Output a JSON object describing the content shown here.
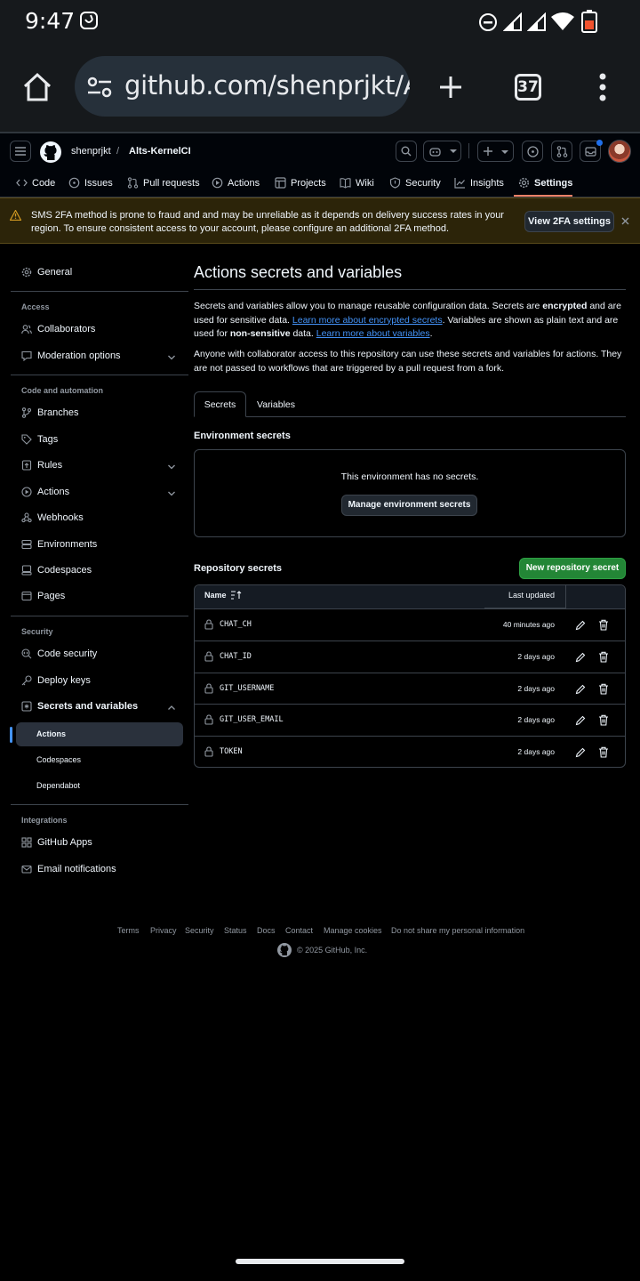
{
  "status_bar": {
    "time": "9:47"
  },
  "browser": {
    "url": "github.com/shenprjkt/Alt",
    "tab_count": "37"
  },
  "header": {
    "owner": "shenprjkt",
    "separator": "/",
    "repo": "Alts-KernelCI"
  },
  "repo_nav": {
    "tabs": [
      "Code",
      "Issues",
      "Pull requests",
      "Actions",
      "Projects",
      "Wiki",
      "Security",
      "Insights",
      "Settings"
    ],
    "active_tab": "Settings"
  },
  "banner": {
    "message": "SMS 2FA method is prone to fraud and and may be unreliable as it depends on delivery success rates in your region. To ensure consistent access to your account, please configure an additional 2FA method.",
    "button": "View 2FA settings"
  },
  "sidebar": {
    "general": "General",
    "access_heading": "Access",
    "collaborators": "Collaborators",
    "moderation": "Moderation options",
    "code_heading": "Code and automation",
    "branches": "Branches",
    "tags": "Tags",
    "rules": "Rules",
    "actions": "Actions",
    "webhooks": "Webhooks",
    "environments": "Environments",
    "codespaces": "Codespaces",
    "pages": "Pages",
    "security_heading": "Security",
    "code_security": "Code security",
    "deploy_keys": "Deploy keys",
    "secrets_vars": "Secrets and variables",
    "sub_actions": "Actions",
    "sub_codespaces": "Codespaces",
    "sub_dependabot": "Dependabot",
    "integrations_heading": "Integrations",
    "github_apps": "GitHub Apps",
    "email_notifications": "Email notifications"
  },
  "main": {
    "title": "Actions secrets and variables",
    "p1_a": "Secrets and variables allow you to manage reusable configuration data. Secrets are ",
    "p1_b": "encrypted",
    "p1_c": " and are used for sensitive data. ",
    "p1_link1": "Learn more about encrypted secrets",
    "p1_d": ". Variables are shown as plain text and are used for ",
    "p1_e": "non-sensitive",
    "p1_f": " data. ",
    "p1_link2": "Learn more about variables",
    "p1_g": ".",
    "p2": "Anyone with collaborator access to this repository can use these secrets and variables for actions. They are not passed to workflows that are triggered by a pull request from a fork.",
    "tab_secrets": "Secrets",
    "tab_variables": "Variables",
    "env_title": "Environment secrets",
    "env_empty": "This environment has no secrets.",
    "env_button": "Manage environment secrets",
    "repo_title": "Repository secrets",
    "new_button": "New repository secret",
    "col_name": "Name",
    "col_updated": "Last updated",
    "secrets": [
      {
        "name": "CHAT_CH",
        "updated": "40 minutes ago"
      },
      {
        "name": "CHAT_ID",
        "updated": "2 days ago"
      },
      {
        "name": "GIT_USERNAME",
        "updated": "2 days ago"
      },
      {
        "name": "GIT_USER_EMAIL",
        "updated": "2 days ago"
      },
      {
        "name": "TOKEN",
        "updated": "2 days ago"
      }
    ]
  },
  "footer": {
    "links": [
      "Terms",
      "Privacy",
      "Security",
      "Status",
      "Docs",
      "Contact",
      "Manage cookies",
      "Do not share my personal information"
    ],
    "copyright": "© 2025 GitHub, Inc."
  },
  "colors": {
    "accent_blue": "#4493f8",
    "green_button": "#238636",
    "tab_underline": "#f78166",
    "warning_bg": "#2c2409"
  }
}
